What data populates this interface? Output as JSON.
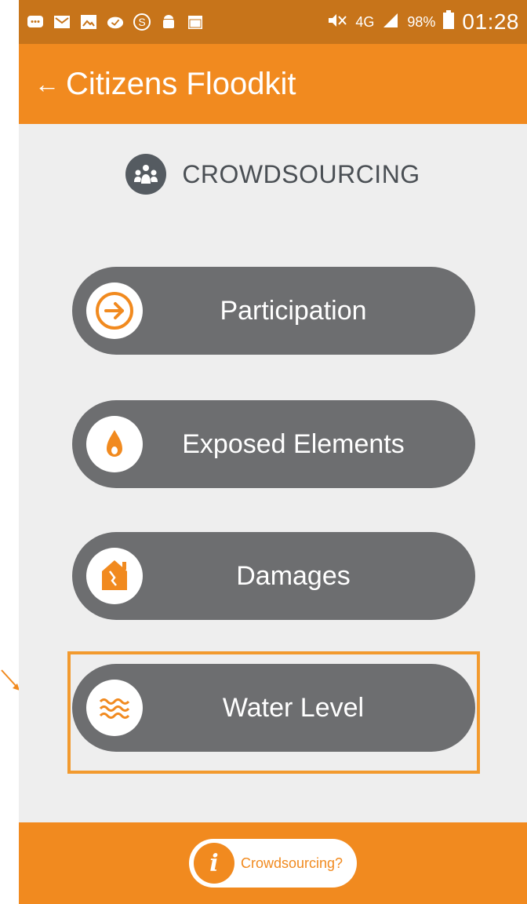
{
  "status_bar": {
    "signal_label": "4G",
    "battery": "98%",
    "time": "01:28"
  },
  "app_bar": {
    "back_glyph": "←",
    "title": "Citizens Floodkit"
  },
  "section": {
    "title": "CROWDSOURCING",
    "icon": "group-icon"
  },
  "menu": {
    "items": [
      {
        "label": "Participation",
        "icon": "arrow-right-icon"
      },
      {
        "label": "Exposed Elements",
        "icon": "drop-icon"
      },
      {
        "label": "Damages",
        "icon": "house-icon"
      },
      {
        "label": "Water Level",
        "icon": "waves-icon"
      }
    ]
  },
  "bottom": {
    "help_glyph": "i",
    "help_label": "Crowdsourcing?"
  },
  "colors": {
    "primary": "#f18a1f",
    "status_bar": "#c7741a",
    "button": "#6d6e70",
    "background": "#eeeeee",
    "highlight": "#f29a2e"
  }
}
